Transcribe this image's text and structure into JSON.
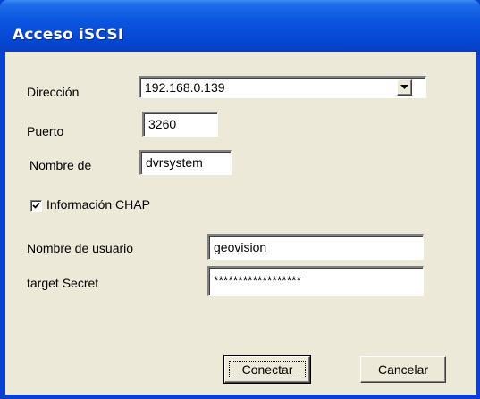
{
  "window": {
    "title": "Acceso iSCSI"
  },
  "form": {
    "address_label": "Dirección",
    "address_value": "192.168.0.139",
    "port_label": "Puerto",
    "port_value": "3260",
    "name_label": "Nombre de",
    "name_value": "dvrsystem",
    "chap_label": "Información CHAP",
    "chap_checked": true,
    "username_label": "Nombre de usuario",
    "username_value": "geovision",
    "secret_label": "target Secret",
    "secret_value": "******************"
  },
  "buttons": {
    "connect_label": "Conectar",
    "cancel_label": "Cancelar"
  },
  "icons": {
    "combo_arrow": "chevron-down-icon",
    "check": "check-icon"
  }
}
